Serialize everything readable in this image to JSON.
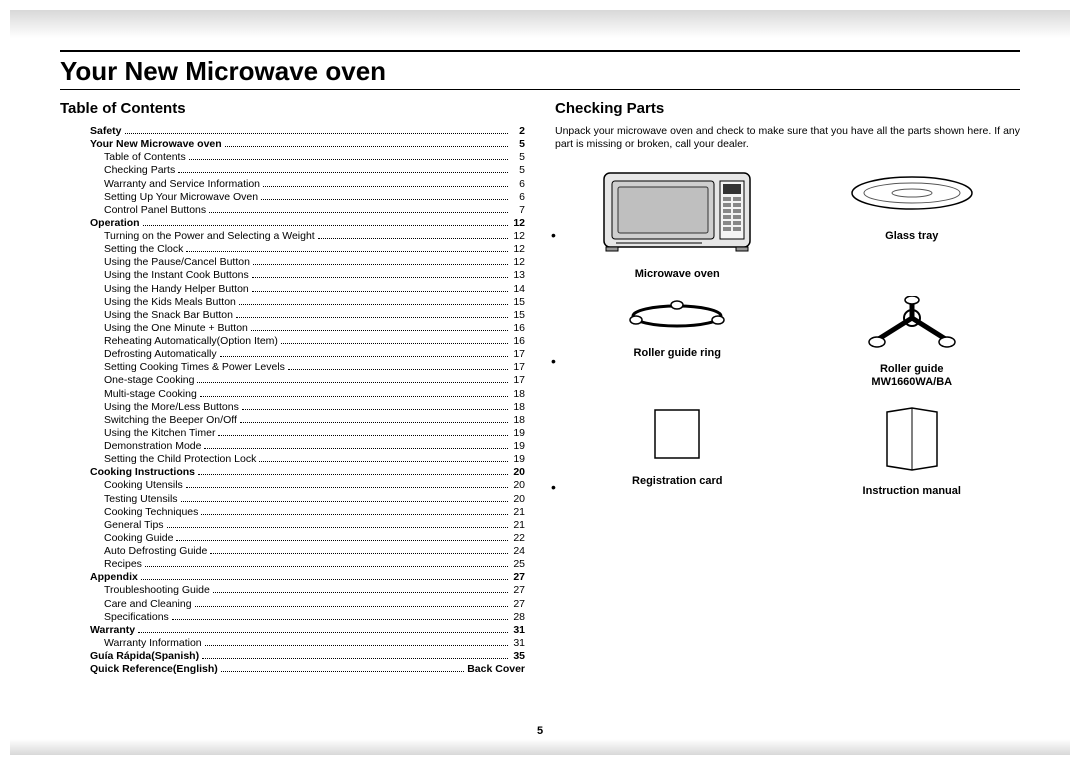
{
  "title": "Your New Microwave oven",
  "page_number": "5",
  "left": {
    "heading": "Table of Contents",
    "toc": [
      {
        "label": "Safety",
        "page": "2",
        "bold": true,
        "sub": false
      },
      {
        "label": "Your New Microwave oven",
        "page": "5",
        "bold": true,
        "sub": false
      },
      {
        "label": "Table of Contents",
        "page": "5",
        "bold": false,
        "sub": true
      },
      {
        "label": "Checking Parts",
        "page": "5",
        "bold": false,
        "sub": true
      },
      {
        "label": "Warranty and Service Information",
        "page": "6",
        "bold": false,
        "sub": true
      },
      {
        "label": "Setting Up Your Microwave Oven",
        "page": "6",
        "bold": false,
        "sub": true
      },
      {
        "label": "Control Panel Buttons",
        "page": "7",
        "bold": false,
        "sub": true
      },
      {
        "label": "Operation",
        "page": "12",
        "bold": true,
        "sub": false
      },
      {
        "label": "Turning on the Power and Selecting a Weight",
        "page": "12",
        "bold": false,
        "sub": true
      },
      {
        "label": "Setting the Clock",
        "page": "12",
        "bold": false,
        "sub": true
      },
      {
        "label": "Using the Pause/Cancel Button",
        "page": "12",
        "bold": false,
        "sub": true
      },
      {
        "label": "Using the Instant Cook Buttons",
        "page": "13",
        "bold": false,
        "sub": true
      },
      {
        "label": "Using the Handy Helper Button",
        "page": "14",
        "bold": false,
        "sub": true
      },
      {
        "label": "Using the Kids Meals Button",
        "page": "15",
        "bold": false,
        "sub": true
      },
      {
        "label": "Using the Snack Bar Button",
        "page": "15",
        "bold": false,
        "sub": true
      },
      {
        "label": "Using the One Minute + Button",
        "page": "16",
        "bold": false,
        "sub": true
      },
      {
        "label": "Reheating Automatically(Option Item)",
        "page": "16",
        "bold": false,
        "sub": true
      },
      {
        "label": "Defrosting Automatically",
        "page": "17",
        "bold": false,
        "sub": true
      },
      {
        "label": "Setting Cooking Times & Power Levels",
        "page": "17",
        "bold": false,
        "sub": true
      },
      {
        "label": "One-stage Cooking",
        "page": "17",
        "bold": false,
        "sub": true
      },
      {
        "label": "Multi-stage Cooking",
        "page": "18",
        "bold": false,
        "sub": true
      },
      {
        "label": "Using the More/Less Buttons",
        "page": "18",
        "bold": false,
        "sub": true
      },
      {
        "label": "Switching the Beeper On/Off",
        "page": "18",
        "bold": false,
        "sub": true
      },
      {
        "label": "Using the Kitchen Timer",
        "page": "19",
        "bold": false,
        "sub": true
      },
      {
        "label": "Demonstration Mode",
        "page": "19",
        "bold": false,
        "sub": true
      },
      {
        "label": "Setting the Child Protection Lock",
        "page": "19",
        "bold": false,
        "sub": true
      },
      {
        "label": "Cooking Instructions",
        "page": "20",
        "bold": true,
        "sub": false
      },
      {
        "label": "Cooking Utensils",
        "page": "20",
        "bold": false,
        "sub": true
      },
      {
        "label": "Testing Utensils",
        "page": "20",
        "bold": false,
        "sub": true
      },
      {
        "label": "Cooking Techniques",
        "page": "21",
        "bold": false,
        "sub": true
      },
      {
        "label": "General Tips",
        "page": "21",
        "bold": false,
        "sub": true
      },
      {
        "label": "Cooking Guide",
        "page": "22",
        "bold": false,
        "sub": true
      },
      {
        "label": "Auto Defrosting Guide",
        "page": "24",
        "bold": false,
        "sub": true
      },
      {
        "label": "Recipes",
        "page": "25",
        "bold": false,
        "sub": true
      },
      {
        "label": "Appendix",
        "page": "27",
        "bold": true,
        "sub": false
      },
      {
        "label": "Troubleshooting Guide",
        "page": "27",
        "bold": false,
        "sub": true
      },
      {
        "label": "Care and Cleaning",
        "page": "27",
        "bold": false,
        "sub": true
      },
      {
        "label": "Specifications",
        "page": "28",
        "bold": false,
        "sub": true
      },
      {
        "label": "Warranty",
        "page": "31",
        "bold": true,
        "sub": false
      },
      {
        "label": "Warranty Information",
        "page": "31",
        "bold": false,
        "sub": true
      },
      {
        "label": "Guía Rápida(Spanish)",
        "page": "35",
        "bold": true,
        "sub": false
      },
      {
        "label": "Quick Reference(English)",
        "page": "Back Cover",
        "bold": true,
        "sub": false
      }
    ]
  },
  "right": {
    "heading": "Checking Parts",
    "intro": "Unpack your microwave oven and check to make sure that you have all the parts shown here. If any part is missing or broken, call your dealer.",
    "parts": [
      {
        "label": "Microwave oven"
      },
      {
        "label": "Glass tray"
      },
      {
        "label": "Roller guide ring"
      },
      {
        "label": "Roller guide\nMW1660WA/BA"
      },
      {
        "label": "Registration card"
      },
      {
        "label": "Instruction manual"
      }
    ]
  }
}
